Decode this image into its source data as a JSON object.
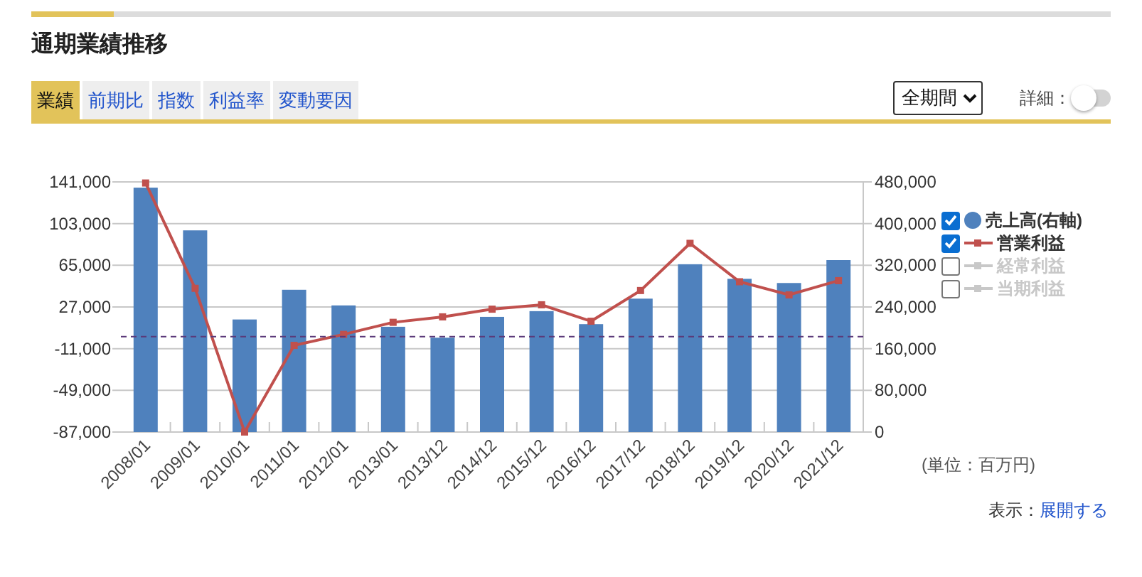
{
  "header": {
    "title": "通期業績推移"
  },
  "tabs": [
    {
      "label": "業績",
      "selected": true
    },
    {
      "label": "前期比",
      "selected": false
    },
    {
      "label": "指数",
      "selected": false
    },
    {
      "label": "利益率",
      "selected": false
    },
    {
      "label": "変動要因",
      "selected": false
    }
  ],
  "period_select": {
    "value": "全期間"
  },
  "detail_toggle": {
    "label": "詳細：",
    "on": false
  },
  "chart": {
    "chart_data": {
      "type": "bar",
      "categories": [
        "2008/01",
        "2009/01",
        "2010/01",
        "2011/01",
        "2012/01",
        "2013/01",
        "2013/12",
        "2014/12",
        "2015/12",
        "2016/12",
        "2017/12",
        "2018/12",
        "2019/12",
        "2020/12",
        "2021/12"
      ],
      "series": [
        {
          "name": "売上高(右軸)",
          "type": "bar",
          "axis": "y2",
          "color": "#4f81bd",
          "values": [
            469000,
            387000,
            216000,
            273000,
            243000,
            202000,
            181000,
            221000,
            232000,
            207000,
            256000,
            322000,
            294000,
            286000,
            330000
          ]
        },
        {
          "name": "営業利益",
          "type": "line",
          "marker": "square",
          "color": "#c0504d",
          "values": [
            140000,
            44000,
            -87000,
            -8000,
            2000,
            13000,
            18000,
            25000,
            29000,
            14000,
            42000,
            85000,
            50000,
            38000,
            51000
          ]
        }
      ],
      "ylim": [
        -87000,
        141000
      ],
      "yticks": [
        {
          "value": 141000,
          "label": "141,000"
        },
        {
          "value": 103000,
          "label": "103,000"
        },
        {
          "value": 65000,
          "label": "65,000"
        },
        {
          "value": 27000,
          "label": "27,000"
        },
        {
          "value": -11000,
          "label": "-11,000"
        },
        {
          "value": -49000,
          "label": "-49,000"
        },
        {
          "value": -87000,
          "label": "-87,000"
        }
      ],
      "y2lim": [
        0,
        480000
      ],
      "y2ticks": [
        {
          "value": 480000,
          "label": "480,000"
        },
        {
          "value": 400000,
          "label": "400,000"
        },
        {
          "value": 320000,
          "label": "320,000"
        },
        {
          "value": 240000,
          "label": "240,000"
        },
        {
          "value": 160000,
          "label": "160,000"
        },
        {
          "value": 80000,
          "label": "80,000"
        },
        {
          "value": 0,
          "label": "0"
        }
      ],
      "grid": true,
      "ref_lines": [
        {
          "value": 0,
          "axis": "y"
        }
      ]
    }
  },
  "legend": [
    {
      "checked": true,
      "kind": "bar"
    },
    {
      "checked": true,
      "kind": "line"
    },
    {
      "label": "経常利益",
      "checked": false,
      "kind": "line",
      "color": "#c8c8c8"
    },
    {
      "label": "当期利益",
      "checked": false,
      "kind": "line",
      "color": "#c8c8c8"
    }
  ],
  "unit_label": "(単位：百万円)",
  "footer": {
    "label": "表示：",
    "link": "展開する"
  }
}
